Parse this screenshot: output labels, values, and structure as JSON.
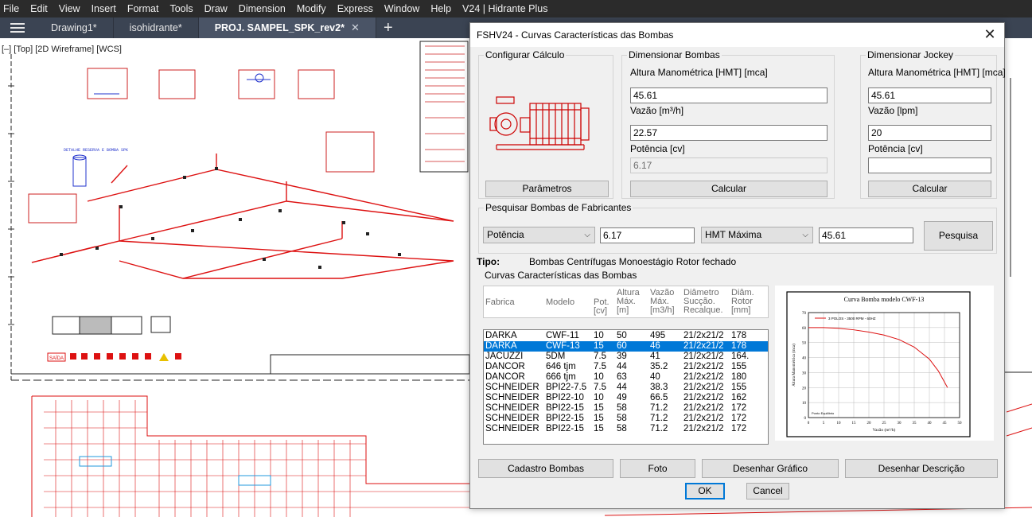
{
  "menubar": {
    "items": [
      "File",
      "Edit",
      "View",
      "Insert",
      "Format",
      "Tools",
      "Draw",
      "Dimension",
      "Modify",
      "Express",
      "Window",
      "Help",
      "V24 | Hidrante Plus"
    ]
  },
  "tabs": [
    {
      "label": "Drawing1*",
      "active": false
    },
    {
      "label": "isohidrante*",
      "active": false
    },
    {
      "label": "PROJ. SAMPEL_SPK_rev2*",
      "active": true,
      "close": "✕"
    }
  ],
  "tab_add": "+",
  "viewport_label": "[–] [Top] [2D Wireframe] [WCS]",
  "drawing_annotations": {
    "detalhe": "DETALHE RESERVA E BOMBA SPK",
    "saida": "SAÍDA"
  },
  "dialog": {
    "title": "FSHV24 - Curvas Características das Bombas",
    "close": "✕",
    "configurar": {
      "label": "Configurar Cálculo",
      "button": "Parâmetros"
    },
    "dimensionar_bombas": {
      "label": "Dimensionar Bombas",
      "hmt_label": "Altura Manométrica [HMT] [mca]",
      "hmt_value": "45.61",
      "vazao_label": "Vazão [m³/h]",
      "vazao_value": "22.57",
      "potencia_label": "Potência [cv]",
      "potencia_value": "6.17",
      "button": "Calcular"
    },
    "dimensionar_jockey": {
      "label": "Dimensionar Jockey",
      "hmt_label": "Altura Manométrica [HMT] [mca]",
      "hmt_value": "45.61",
      "vazao_label": "Vazão [lpm]",
      "vazao_value": "20",
      "potencia_label": "Potência [cv]",
      "potencia_value": "",
      "button": "Calcular"
    },
    "pesquisar": {
      "label": "Pesquisar Bombas de Fabricantes",
      "filter1": "Potência",
      "filter1_value": "6.17",
      "filter2": "HMT Máxima",
      "filter2_value": "45.61",
      "button": "Pesquisa"
    },
    "tipo": {
      "label": "Tipo:",
      "value": "Bombas Centrífugas Monoestágio Rotor fechado"
    },
    "curvas_group_label": "Curvas Características das Bombas",
    "table": {
      "headers": {
        "fabrica": "Fabrica",
        "modelo": "Modelo",
        "pot": [
          "Pot.",
          "[cv]"
        ],
        "altura": [
          "Altura",
          "Máx.",
          "[m]"
        ],
        "vazao": [
          "Vazão",
          "Máx.",
          "[m3/h]"
        ],
        "diametro": [
          "Diâmetro",
          "Sucção.",
          "Recalque."
        ],
        "diam_rotor": [
          "Diâm.",
          "Rotor",
          "[mm]"
        ]
      },
      "rows": [
        {
          "fabrica": "DARKA",
          "modelo": "CWF-11",
          "pot": "10",
          "altura": "50",
          "vazao": "495",
          "diametro": "21/2x21/2",
          "rotor": "178"
        },
        {
          "fabrica": "DARKA",
          "modelo": "CWF-13",
          "pot": "15",
          "altura": "60",
          "vazao": "46",
          "diametro": "21/2x21/2",
          "rotor": "178"
        },
        {
          "fabrica": "JACUZZI",
          "modelo": "5DM",
          "pot": "7.5",
          "altura": "39",
          "vazao": "41",
          "diametro": "21/2x21/2",
          "rotor": "164."
        },
        {
          "fabrica": "DANCOR",
          "modelo": "646 tjm",
          "pot": "7.5",
          "altura": "44",
          "vazao": "35.2",
          "diametro": "21/2x21/2",
          "rotor": "155"
        },
        {
          "fabrica": "DANCOR",
          "modelo": "666 tjm",
          "pot": "10",
          "altura": "63",
          "vazao": "40",
          "diametro": "21/2x21/2",
          "rotor": "180"
        },
        {
          "fabrica": "SCHNEIDER",
          "modelo": "BPI22-7.5",
          "pot": "7.5",
          "altura": "44",
          "vazao": "38.3",
          "diametro": "21/2x21/2",
          "rotor": "155"
        },
        {
          "fabrica": "SCHNEIDER",
          "modelo": "BPI22-10",
          "pot": "10",
          "altura": "49",
          "vazao": "66.5",
          "diametro": "21/2x21/2",
          "rotor": "162"
        },
        {
          "fabrica": "SCHNEIDER",
          "modelo": "BPI22-15",
          "pot": "15",
          "altura": "58",
          "vazao": "71.2",
          "diametro": "21/2x21/2",
          "rotor": "172"
        },
        {
          "fabrica": "SCHNEIDER",
          "modelo": "BPI22-15",
          "pot": "15",
          "altura": "58",
          "vazao": "71.2",
          "diametro": "21/2x21/2",
          "rotor": "172"
        },
        {
          "fabrica": "SCHNEIDER",
          "modelo": "BPI22-15",
          "pot": "15",
          "altura": "58",
          "vazao": "71.2",
          "diametro": "21/2x21/2",
          "rotor": "172"
        }
      ],
      "selected_index": 1
    },
    "graph": {
      "title": "Curva Bomba modelo CWF-13",
      "legend": "3 POLOS - 3500 RPM - 60HZ",
      "xlabel": "Vazão (m³/h)",
      "ylabel": "Altura Manométrica (mca)",
      "annotation": "Ponto Equilíbrio",
      "xticks": [
        "0",
        "5",
        "10",
        "15",
        "20",
        "25",
        "30",
        "35",
        "40",
        "45",
        "50"
      ],
      "yticks": [
        "0",
        "10",
        "20",
        "30",
        "40",
        "50",
        "60",
        "70"
      ]
    },
    "buttons": {
      "cadastro": "Cadastro Bombas",
      "foto": "Foto",
      "desenhar_grafico": "Desenhar Gráfico",
      "desenhar_descricao": "Desenhar Descrição",
      "ok": "OK",
      "cancel": "Cancel"
    },
    "accent_color": "#0078d7"
  },
  "chart_data": {
    "type": "line",
    "title": "Curva Bomba modelo CWF-13",
    "xlabel": "Vazão (m³/h)",
    "ylabel": "Altura Manométrica (mca)",
    "xlim": [
      0,
      50
    ],
    "ylim": [
      0,
      70
    ],
    "grid": true,
    "legend": "top-left",
    "series": [
      {
        "name": "3 POLOS - 3500 RPM - 60HZ",
        "x": [
          0,
          5,
          10,
          15,
          20,
          25,
          30,
          35,
          40,
          43,
          46
        ],
        "y": [
          60,
          60,
          59.5,
          58.5,
          57,
          55,
          52,
          47,
          39,
          31,
          20
        ]
      }
    ]
  }
}
